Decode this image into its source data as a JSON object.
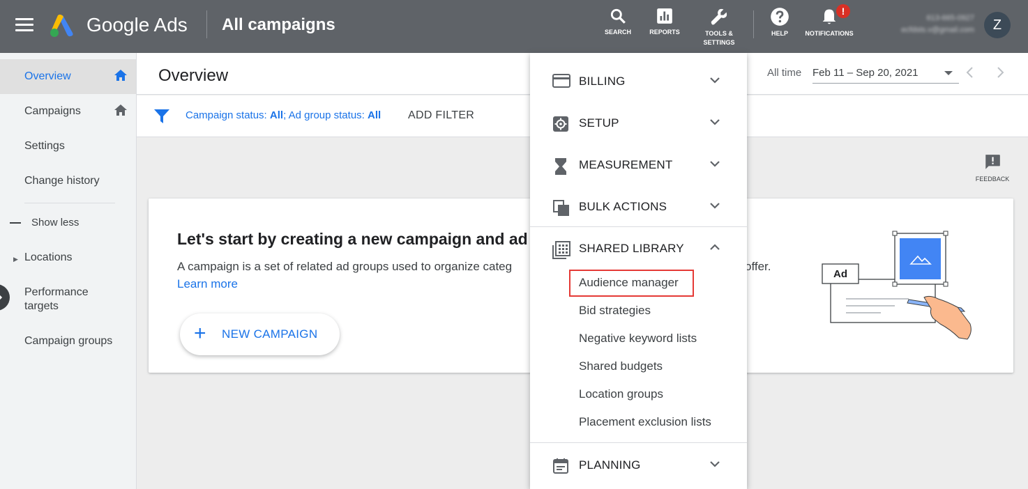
{
  "topbar": {
    "brand": "Google Ads",
    "context_title": "All campaigns",
    "tools": [
      {
        "label": "SEARCH",
        "icon": "search-icon"
      },
      {
        "label": "REPORTS",
        "icon": "reports-icon"
      },
      {
        "label": "TOOLS &",
        "label2": "SETTINGS",
        "icon": "wrench-icon"
      },
      {
        "label": "HELP",
        "icon": "help-icon"
      },
      {
        "label": "NOTIFICATIONS",
        "icon": "bell-icon",
        "badge": "!"
      }
    ],
    "account_line1": "613-665-0927",
    "account_line2": "ecfdsts.v@gmail.com",
    "avatar_letter": "Z"
  },
  "sidebar": {
    "items": [
      {
        "label": "Overview",
        "active": true
      },
      {
        "label": "Campaigns"
      },
      {
        "label": "Settings"
      },
      {
        "label": "Change history"
      },
      {
        "label": "Show less"
      },
      {
        "label": "Locations"
      },
      {
        "label": "Performance targets"
      },
      {
        "label": "Campaign groups"
      }
    ]
  },
  "header": {
    "title": "Overview",
    "range_label": "All time",
    "range_value": "Feb 11 – Sep 20, 2021"
  },
  "filter": {
    "campaign_status_label": "Campaign status: ",
    "campaign_status_value": "All",
    "separator": "; ",
    "adgroup_status_label": "Ad group status: ",
    "adgroup_status_value": "All",
    "add_filter": "ADD FILTER"
  },
  "feedback": {
    "label": "FEEDBACK"
  },
  "card": {
    "title": "Let's start by creating a new campaign and ad",
    "description": "A campaign is a set of related ad groups used to organize categ",
    "description_tail": "offer.",
    "learn_more": "Learn more",
    "button_label": "NEW CAMPAIGN",
    "illustration_label": "Ad"
  },
  "menu": {
    "categories": [
      {
        "label": "BILLING",
        "icon": "credit-card-icon"
      },
      {
        "label": "SETUP",
        "icon": "gear-icon"
      },
      {
        "label": "MEASUREMENT",
        "icon": "hourglass-icon"
      },
      {
        "label": "BULK ACTIONS",
        "icon": "copy-icon"
      },
      {
        "label": "SHARED LIBRARY",
        "icon": "grid-library-icon",
        "expanded": true
      },
      {
        "label": "PLANNING",
        "icon": "calendar-icon"
      }
    ],
    "shared_library_items": [
      "Audience manager",
      "Bid strategies",
      "Negative keyword lists",
      "Shared budgets",
      "Location groups",
      "Placement exclusion lists"
    ],
    "highlighted_item": "Audience manager"
  },
  "colors": {
    "topbar": "#5f6368",
    "accent": "#1a73e8",
    "highlight": "#e53935",
    "alert": "#d93025"
  }
}
